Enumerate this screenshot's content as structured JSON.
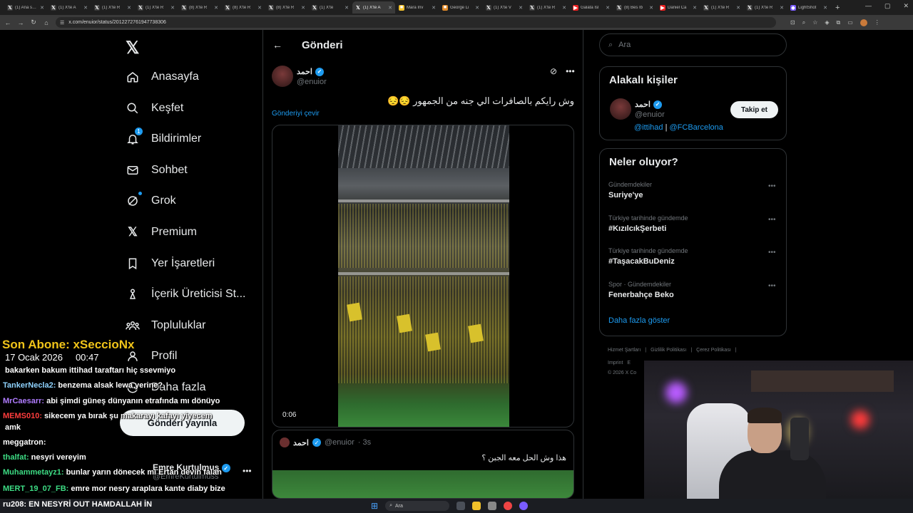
{
  "browser": {
    "tabs": [
      {
        "title": "(1) Ana sayfa",
        "fav": "𝕏",
        "color": "#3a3a3a"
      },
      {
        "title": "(1) X'te A",
        "fav": "𝕏",
        "color": "#3a3a3a"
      },
      {
        "title": "(1) X'te R",
        "fav": "𝕏",
        "color": "#3a3a3a"
      },
      {
        "title": "(1) X'te R",
        "fav": "𝕏",
        "color": "#3a3a3a"
      },
      {
        "title": "(8) X'te R",
        "fav": "𝕏",
        "color": "#3a3a3a"
      },
      {
        "title": "(8) X'te R",
        "fav": "𝕏",
        "color": "#3a3a3a"
      },
      {
        "title": "(8) X'te R",
        "fav": "𝕏",
        "color": "#3a3a3a"
      },
      {
        "title": "(1) X'te",
        "fav": "𝕏",
        "color": "#3a3a3a"
      },
      {
        "title": "(1) X'te A",
        "fav": "𝕏",
        "color": "#3a3a3a",
        "active": true
      },
      {
        "title": "Mara Inv",
        "fav": "■",
        "color": "#f2c12e"
      },
      {
        "title": "George Li",
        "fav": "■",
        "color": "#e08a2a"
      },
      {
        "title": "(1) X'te V",
        "fav": "𝕏",
        "color": "#3a3a3a"
      },
      {
        "title": "(1) X'te R",
        "fav": "𝕏",
        "color": "#3a3a3a"
      },
      {
        "title": "Galata Isl",
        "fav": "▶",
        "color": "#e22"
      },
      {
        "title": "(8) Bes Ib",
        "fav": "𝕏",
        "color": "#3a3a3a"
      },
      {
        "title": "Daniel Ca",
        "fav": "▶",
        "color": "#e22"
      },
      {
        "title": "(1) X'te R",
        "fav": "𝕏",
        "color": "#3a3a3a"
      },
      {
        "title": "(1) X'te R",
        "fav": "𝕏",
        "color": "#3a3a3a"
      },
      {
        "title": "LightShot",
        "fav": "◆",
        "color": "#7a5cff"
      }
    ],
    "url": "x.com/enuior/status/2012272761947738306"
  },
  "nav": {
    "items": [
      {
        "label": "Anasayfa",
        "icon": "home-icon"
      },
      {
        "label": "Keşfet",
        "icon": "search-icon"
      },
      {
        "label": "Bildirimler",
        "icon": "bell-icon",
        "badge": "1"
      },
      {
        "label": "Sohbet",
        "icon": "mail-icon"
      },
      {
        "label": "Grok",
        "icon": "grok-icon"
      },
      {
        "label": "Premium",
        "icon": "x-icon"
      },
      {
        "label": "Yer İşaretleri",
        "icon": "bookmark-icon"
      },
      {
        "label": "İçerik Üreticisi St...",
        "icon": "creator-icon"
      },
      {
        "label": "Topluluklar",
        "icon": "communities-icon"
      },
      {
        "label": "Profil",
        "icon": "profile-icon"
      },
      {
        "label": "Daha fazla",
        "icon": "more-icon"
      }
    ],
    "post_button": "Gönderi yayınla",
    "account": {
      "name": "Emre Kurtulmuş",
      "handle": "@EmreKurtulmuss"
    }
  },
  "post": {
    "page_title": "Gönderi",
    "author_name": "احمد",
    "author_handle": "@enuior",
    "text": "وش رايكم بالصافرات الي جنه من الجمهور 😔😔",
    "translate": "Gönderiyi çevir",
    "video_time": "0:06",
    "quote": {
      "name": "احمد",
      "handle": "@enuior",
      "time": "· 3s",
      "text": "هذا وش الحل معه الجبن ؟"
    }
  },
  "right": {
    "search_placeholder": "Ara",
    "related": {
      "title": "Alakalı kişiler",
      "name": "احمد",
      "handle": "@enuior",
      "bio_link1": "@ittihad",
      "bio_sep": " | ",
      "bio_link2": "@FCBarcelona",
      "follow": "Takip et"
    },
    "trends": {
      "title": "Neler oluyor?",
      "items": [
        {
          "meta": "Gündemdekiler",
          "name": "Suriye'ye"
        },
        {
          "meta": "Türkiye tarihinde gündemde",
          "name": "#KızılcıkŞerbeti"
        },
        {
          "meta": "Türkiye tarihinde gündemde",
          "name": "#TaşacakBuDeniz"
        },
        {
          "meta": "Spor · Gündemdekiler",
          "name": "Fenerbahçe Beko"
        }
      ],
      "show_more": "Daha fazla göster"
    },
    "footer": {
      "line1": [
        "Hizmet Şartları",
        "Gizlilik Politikası",
        "Çerez Politikası"
      ],
      "line2": [
        "Imprint",
        "E"
      ],
      "line3": "© 2026 X Co"
    }
  },
  "overlay": {
    "title": "Son Abone: xSeccioNx",
    "date": "17 Ocak 2026",
    "time": "00:47",
    "chat": [
      {
        "user": "",
        "msg": "bakarken bakum ittihad taraftarı hiç ssevmiyo",
        "color": "#ffffff"
      },
      {
        "user": "TankerNecla2:",
        "msg": "benzema alsak lewa yerine?",
        "color": "#8fd3ff"
      },
      {
        "user": "MrCaesarr:",
        "msg": "abi şimdi güneş dünyanın etrafında mı dönüyo",
        "color": "#b07cff"
      },
      {
        "user": "MEMS010:",
        "msg": "sikecem ya bırak şu makarayı kafayı yiyecem",
        "color": "#ff3d3d"
      },
      {
        "user": "",
        "msg": "amk",
        "color": "#ffffff"
      },
      {
        "user": "meggatron:",
        "msg": "",
        "color": "#ffffff"
      },
      {
        "user": "thalfat:",
        "msg": "nesyri vereyim",
        "color": "#3ddc84"
      },
      {
        "user": "Muhammetayz1:",
        "msg": "bunlar yarın dönecek mi Ertan devin falan",
        "color": "#3ddc84"
      },
      {
        "user": "MERT_19_07_FB:",
        "msg": "emre mor nesry araplara kante diaby bize",
        "color": "#3ddc84"
      }
    ],
    "bottom": "ru208: EN NESYRİ OUT HAMDALLAH İN"
  },
  "taskbar": {
    "search": "Ara"
  }
}
